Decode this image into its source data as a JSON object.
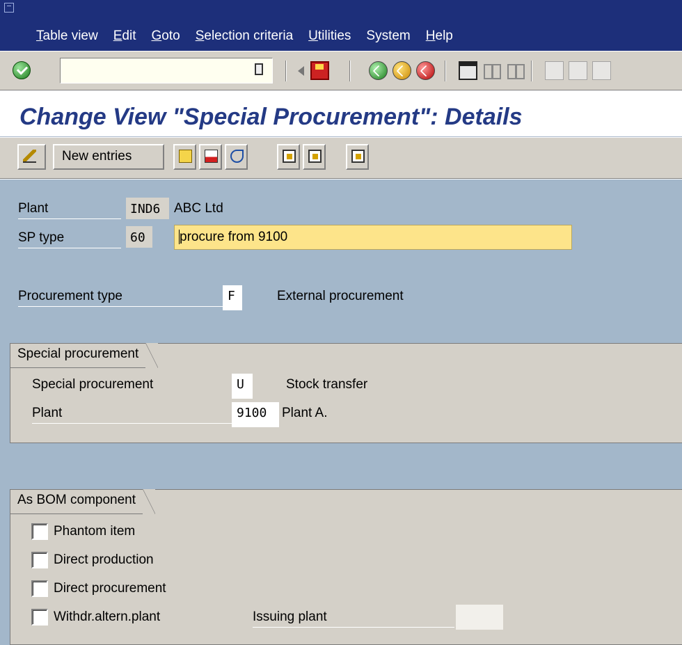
{
  "menu": {
    "items": [
      {
        "mnemonic": "T",
        "rest": "able view"
      },
      {
        "mnemonic": "E",
        "rest": "dit"
      },
      {
        "mnemonic": "G",
        "rest": "oto"
      },
      {
        "mnemonic": "S",
        "rest": "election criteria"
      },
      {
        "mnemonic": "U",
        "rest": "tilities"
      },
      {
        "mnemonic": "",
        "rest": "System"
      },
      {
        "mnemonic": "H",
        "rest": "elp"
      }
    ]
  },
  "command_field": {
    "value": ""
  },
  "screen": {
    "title": "Change View \"Special Procurement\": Details"
  },
  "app_toolbar": {
    "new_entries_label": "New entries"
  },
  "header": {
    "plant_label": "Plant",
    "plant_value": "IND6",
    "plant_name": "ABC Ltd",
    "sp_type_label": "SP type",
    "sp_type_value": "60",
    "sp_type_desc": "procure from 9100",
    "procurement_type_label": "Procurement type",
    "procurement_type_value": "F",
    "procurement_type_text": "External procurement"
  },
  "special_procurement_group": {
    "title": "Special procurement",
    "sp_label": "Special procurement",
    "sp_value": "U",
    "sp_text": "Stock transfer",
    "plant_label": "Plant",
    "plant_value": "9100",
    "plant_text": "Plant A."
  },
  "bom_group": {
    "title": "As BOM component",
    "phantom_item": "Phantom item",
    "direct_production": "Direct production",
    "direct_procurement": "Direct procurement",
    "withdr_altern_plant": "Withdr.altern.plant",
    "issuing_plant_label": "Issuing plant",
    "issuing_plant_value": ""
  }
}
